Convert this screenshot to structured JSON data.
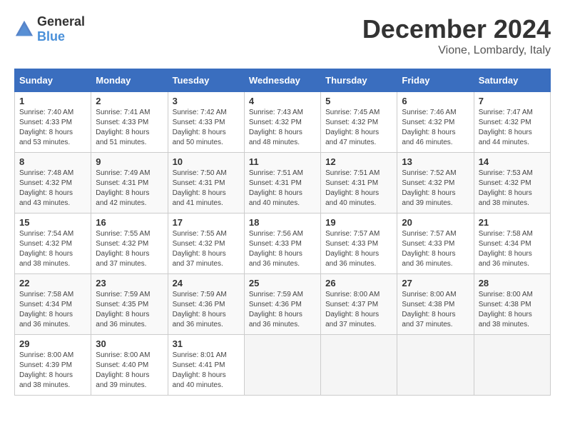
{
  "header": {
    "logo_general": "General",
    "logo_blue": "Blue",
    "month": "December 2024",
    "location": "Vione, Lombardy, Italy"
  },
  "weekdays": [
    "Sunday",
    "Monday",
    "Tuesday",
    "Wednesday",
    "Thursday",
    "Friday",
    "Saturday"
  ],
  "weeks": [
    [
      {
        "day": "1",
        "sunrise": "7:40 AM",
        "sunset": "4:33 PM",
        "daylight": "8 hours and 53 minutes."
      },
      {
        "day": "2",
        "sunrise": "7:41 AM",
        "sunset": "4:33 PM",
        "daylight": "8 hours and 51 minutes."
      },
      {
        "day": "3",
        "sunrise": "7:42 AM",
        "sunset": "4:33 PM",
        "daylight": "8 hours and 50 minutes."
      },
      {
        "day": "4",
        "sunrise": "7:43 AM",
        "sunset": "4:32 PM",
        "daylight": "8 hours and 48 minutes."
      },
      {
        "day": "5",
        "sunrise": "7:45 AM",
        "sunset": "4:32 PM",
        "daylight": "8 hours and 47 minutes."
      },
      {
        "day": "6",
        "sunrise": "7:46 AM",
        "sunset": "4:32 PM",
        "daylight": "8 hours and 46 minutes."
      },
      {
        "day": "7",
        "sunrise": "7:47 AM",
        "sunset": "4:32 PM",
        "daylight": "8 hours and 44 minutes."
      }
    ],
    [
      {
        "day": "8",
        "sunrise": "7:48 AM",
        "sunset": "4:32 PM",
        "daylight": "8 hours and 43 minutes."
      },
      {
        "day": "9",
        "sunrise": "7:49 AM",
        "sunset": "4:31 PM",
        "daylight": "8 hours and 42 minutes."
      },
      {
        "day": "10",
        "sunrise": "7:50 AM",
        "sunset": "4:31 PM",
        "daylight": "8 hours and 41 minutes."
      },
      {
        "day": "11",
        "sunrise": "7:51 AM",
        "sunset": "4:31 PM",
        "daylight": "8 hours and 40 minutes."
      },
      {
        "day": "12",
        "sunrise": "7:51 AM",
        "sunset": "4:31 PM",
        "daylight": "8 hours and 40 minutes."
      },
      {
        "day": "13",
        "sunrise": "7:52 AM",
        "sunset": "4:32 PM",
        "daylight": "8 hours and 39 minutes."
      },
      {
        "day": "14",
        "sunrise": "7:53 AM",
        "sunset": "4:32 PM",
        "daylight": "8 hours and 38 minutes."
      }
    ],
    [
      {
        "day": "15",
        "sunrise": "7:54 AM",
        "sunset": "4:32 PM",
        "daylight": "8 hours and 38 minutes."
      },
      {
        "day": "16",
        "sunrise": "7:55 AM",
        "sunset": "4:32 PM",
        "daylight": "8 hours and 37 minutes."
      },
      {
        "day": "17",
        "sunrise": "7:55 AM",
        "sunset": "4:32 PM",
        "daylight": "8 hours and 37 minutes."
      },
      {
        "day": "18",
        "sunrise": "7:56 AM",
        "sunset": "4:33 PM",
        "daylight": "8 hours and 36 minutes."
      },
      {
        "day": "19",
        "sunrise": "7:57 AM",
        "sunset": "4:33 PM",
        "daylight": "8 hours and 36 minutes."
      },
      {
        "day": "20",
        "sunrise": "7:57 AM",
        "sunset": "4:33 PM",
        "daylight": "8 hours and 36 minutes."
      },
      {
        "day": "21",
        "sunrise": "7:58 AM",
        "sunset": "4:34 PM",
        "daylight": "8 hours and 36 minutes."
      }
    ],
    [
      {
        "day": "22",
        "sunrise": "7:58 AM",
        "sunset": "4:34 PM",
        "daylight": "8 hours and 36 minutes."
      },
      {
        "day": "23",
        "sunrise": "7:59 AM",
        "sunset": "4:35 PM",
        "daylight": "8 hours and 36 minutes."
      },
      {
        "day": "24",
        "sunrise": "7:59 AM",
        "sunset": "4:36 PM",
        "daylight": "8 hours and 36 minutes."
      },
      {
        "day": "25",
        "sunrise": "7:59 AM",
        "sunset": "4:36 PM",
        "daylight": "8 hours and 36 minutes."
      },
      {
        "day": "26",
        "sunrise": "8:00 AM",
        "sunset": "4:37 PM",
        "daylight": "8 hours and 37 minutes."
      },
      {
        "day": "27",
        "sunrise": "8:00 AM",
        "sunset": "4:38 PM",
        "daylight": "8 hours and 37 minutes."
      },
      {
        "day": "28",
        "sunrise": "8:00 AM",
        "sunset": "4:38 PM",
        "daylight": "8 hours and 38 minutes."
      }
    ],
    [
      {
        "day": "29",
        "sunrise": "8:00 AM",
        "sunset": "4:39 PM",
        "daylight": "8 hours and 38 minutes."
      },
      {
        "day": "30",
        "sunrise": "8:00 AM",
        "sunset": "4:40 PM",
        "daylight": "8 hours and 39 minutes."
      },
      {
        "day": "31",
        "sunrise": "8:01 AM",
        "sunset": "4:41 PM",
        "daylight": "8 hours and 40 minutes."
      },
      null,
      null,
      null,
      null
    ]
  ]
}
